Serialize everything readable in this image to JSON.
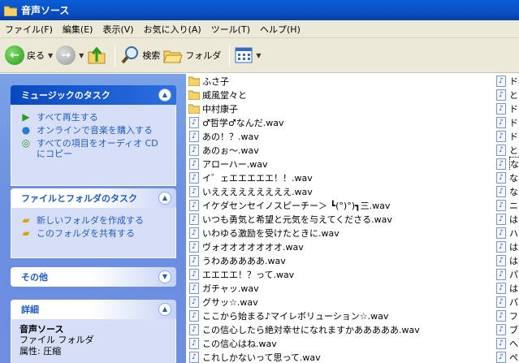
{
  "window": {
    "title": "音声ソース"
  },
  "menu": [
    "ファイル(F)",
    "編集(E)",
    "表示(V)",
    "お気に入り(A)",
    "ツール(T)",
    "ヘルプ(H)"
  ],
  "toolbar": {
    "back": "戻る",
    "search": "検索",
    "folders": "フォルダ"
  },
  "tasks": {
    "music": {
      "title": "ミュージックのタスク",
      "items": [
        "すべて再生する",
        "オンラインで音楽を購入する",
        "すべての項目をオーディオ CD にコピー"
      ]
    },
    "file": {
      "title": "ファイルとフォルダのタスク",
      "items": [
        "新しいフォルダを作成する",
        "このフォルダを共有する"
      ]
    },
    "other": {
      "title": "その他"
    },
    "details": {
      "title": "詳細",
      "name": "音声ソース",
      "type": "ファイル フォルダ",
      "attr": "属性: 圧縮"
    }
  },
  "files": {
    "folders": [
      "ふさ子",
      "威風堂々と",
      "中村康子"
    ],
    "wavs": [
      "♂哲学♂なんだ.wav",
      "あの！？.wav",
      "あのぉ～.wav",
      "アローハー.wav",
      "イ゛ェエエエエエ！！.wav",
      "いえええええええええ.wav",
      "イケダセンセイノスピーチー＞ ┗(°)°)┓三.wav",
      "いつも勇気と希望と元気を与えてくださる.wav",
      "いわゆる激励を受けたときに.wav",
      "ヴォオオオオオオオ.wav",
      "うわあああああ.wav",
      "エエエエ！？って.wav",
      "ガチャッ.wav",
      "グサッ☆.wav",
      "ここから始まる♪マイレボリューション☆.wav",
      "この信心したら絶対幸せになれますかあああああ.wav",
      "この信心はね.wav",
      "これしかないって思って.wav"
    ],
    "col2": [
      "ド",
      "とこ",
      "ドン",
      "ドン",
      "ドン",
      "と思",
      "なに",
      "なん",
      "なん",
      "ニコ",
      "はあ",
      "ハァ",
      "はぁ",
      "は～",
      "パー",
      "はぁ",
      "パー",
      "フェ",
      "ブル",
      "ヘス",
      "ペニ"
    ]
  }
}
